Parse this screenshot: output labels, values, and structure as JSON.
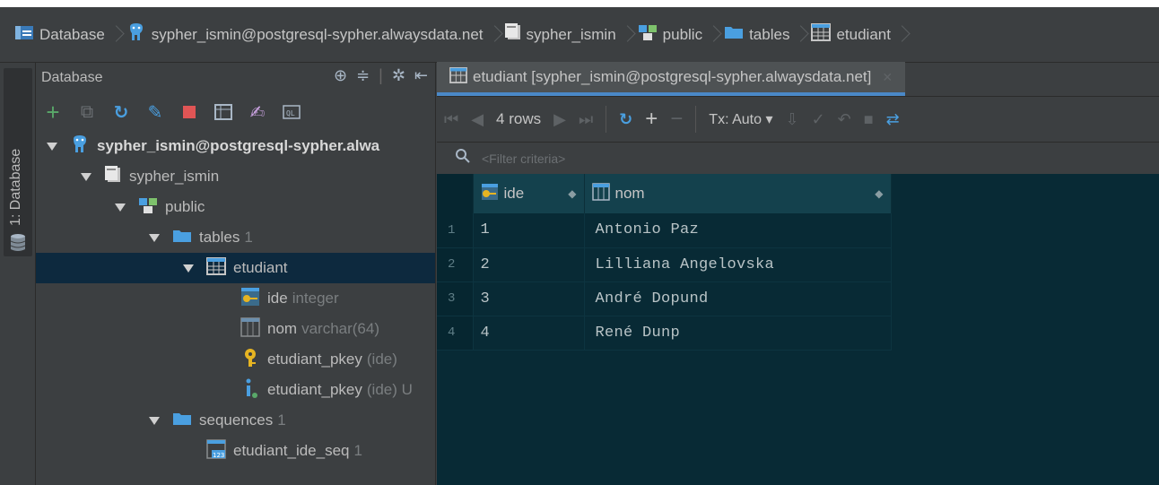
{
  "colors": {
    "accent": "#4a88c7",
    "selection": "#0d293e",
    "grid_bg": "#082a35",
    "header_bg": "#14414d"
  },
  "breadcrumb": [
    {
      "label": "Database",
      "icon": "database-icon"
    },
    {
      "label": "sypher_ismin@postgresql-sypher.alwaysdata.net",
      "icon": "postgres-elephant-icon"
    },
    {
      "label": "sypher_ismin",
      "icon": "schema-db-icon"
    },
    {
      "label": "public",
      "icon": "schema-icon"
    },
    {
      "label": "tables",
      "icon": "folder-icon"
    },
    {
      "label": "etudiant",
      "icon": "table-icon"
    }
  ],
  "sidebar": {
    "tab_label": "1: Database",
    "header": "Database",
    "tree": [
      {
        "indent": 0,
        "label": "sypher_ismin@postgresql-sypher.alwa",
        "suffix": "",
        "arrow": true,
        "icon": "postgres-elephant-icon",
        "bold": true
      },
      {
        "indent": 1,
        "label": "sypher_ismin",
        "suffix": "",
        "arrow": true,
        "icon": "schema-db-icon"
      },
      {
        "indent": 2,
        "label": "public",
        "suffix": "",
        "arrow": true,
        "icon": "schema-icon"
      },
      {
        "indent": 3,
        "label": "tables",
        "suffix": "1",
        "arrow": true,
        "icon": "folder-icon"
      },
      {
        "indent": 4,
        "label": "etudiant",
        "suffix": "",
        "arrow": true,
        "icon": "table-icon",
        "selected": true
      },
      {
        "indent": 5,
        "label": "ide",
        "suffix": "integer",
        "arrow": false,
        "icon": "key-column-icon"
      },
      {
        "indent": 5,
        "label": "nom",
        "suffix": "varchar(64)",
        "arrow": false,
        "icon": "column-icon"
      },
      {
        "indent": 5,
        "label": "etudiant_pkey",
        "suffix": "(ide)",
        "arrow": false,
        "icon": "primary-key-icon"
      },
      {
        "indent": 5,
        "label": "etudiant_pkey",
        "suffix": "(ide) U",
        "arrow": false,
        "icon": "index-icon"
      },
      {
        "indent": 3,
        "label": "sequences",
        "suffix": "1",
        "arrow": true,
        "icon": "folder-icon"
      },
      {
        "indent": 4,
        "label": "etudiant_ide_seq",
        "suffix": "1",
        "arrow": false,
        "icon": "sequence-icon"
      }
    ]
  },
  "editor": {
    "tab_label": "etudiant [sypher_ismin@postgresql-sypher.alwaysdata.net]",
    "rows_label": "4 rows",
    "tx_label": "Tx: Auto",
    "filter_placeholder": "<Filter criteria>",
    "columns": [
      {
        "name": "ide",
        "icon": "key-column-icon"
      },
      {
        "name": "nom",
        "icon": "column-icon"
      }
    ],
    "rows": [
      {
        "n": "1",
        "ide": "1",
        "nom": "Antonio Paz"
      },
      {
        "n": "2",
        "ide": "2",
        "nom": "Lilliana Angelovska"
      },
      {
        "n": "3",
        "ide": "3",
        "nom": "André Dopund"
      },
      {
        "n": "4",
        "ide": "4",
        "nom": "René Dunp"
      }
    ]
  }
}
